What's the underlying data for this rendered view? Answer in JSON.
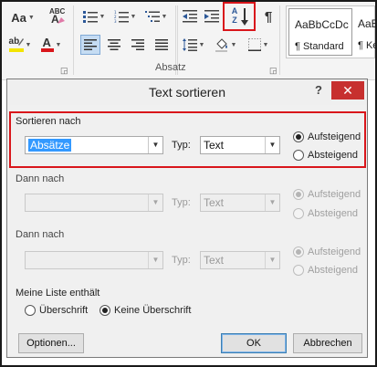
{
  "ribbon": {
    "font_size_label": "Aa",
    "clear_format_label": "A",
    "sort_label": "A Z",
    "pilcrow_label": "¶",
    "font_color_label": "A",
    "group_label": "Absatz",
    "styles": [
      {
        "sample": "AaBbCcDc",
        "name": "¶ Standard"
      },
      {
        "sample": "AaB",
        "name": "¶ Ke"
      }
    ],
    "colors": {
      "highlight": "#f3e400",
      "font_color": "#d9161b",
      "accent_red": "#d9161b"
    }
  },
  "dialog": {
    "title": "Text sortieren",
    "help": "?",
    "close": "✕",
    "sort_by": {
      "label": "Sortieren nach",
      "value": "Absätze",
      "type_label": "Typ:",
      "type_value": "Text",
      "ascending": "Aufsteigend",
      "descending": "Absteigend",
      "selected": "ascending"
    },
    "then_by_1": {
      "label": "Dann nach",
      "value": "",
      "type_label": "Typ:",
      "type_value": "Text",
      "ascending": "Aufsteigend",
      "descending": "Absteigend",
      "selected": "ascending"
    },
    "then_by_2": {
      "label": "Dann nach",
      "value": "",
      "type_label": "Typ:",
      "type_value": "Text",
      "ascending": "Aufsteigend",
      "descending": "Absteigend",
      "selected": "ascending"
    },
    "list_contains": {
      "label": "Meine Liste enthält",
      "header_row": "Überschrift",
      "no_header_row": "Keine Überschrift",
      "selected": "no_header_row"
    },
    "buttons": {
      "options": "Optionen...",
      "ok": "OK",
      "cancel": "Abbrechen"
    }
  }
}
